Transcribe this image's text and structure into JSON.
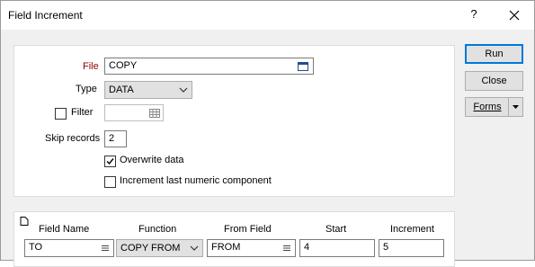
{
  "window": {
    "title": "Field Increment",
    "help_label": "?"
  },
  "form": {
    "file_label": "File",
    "file_value": "COPY",
    "type_label": "Type",
    "type_value": "DATA",
    "filter_label": "Filter",
    "filter_value": "",
    "filter_checked": false,
    "skip_label": "Skip records",
    "skip_value": "2",
    "overwrite_label": "Overwrite data",
    "overwrite_checked": true,
    "increment_last_label": "Increment last numeric component",
    "increment_last_checked": false
  },
  "buttons": {
    "run": "Run",
    "close": "Close",
    "forms": "Forms"
  },
  "grid": {
    "headers": [
      "Field Name",
      "Function",
      "From Field",
      "Start",
      "Increment"
    ],
    "row": {
      "field_name": "TO",
      "function": "COPY FROM",
      "from_field": "FROM",
      "start": "4",
      "increment": "5"
    }
  },
  "colors": {
    "file_label": "#8b0000",
    "default_button_border": "#0078d7",
    "dialog_background": "#f0f0f0"
  },
  "icons": {
    "file_browse": "window-browse-icon",
    "filter_browse": "table-browse-icon",
    "new_row": "new-document-icon",
    "ellipsis": "list-icon"
  }
}
